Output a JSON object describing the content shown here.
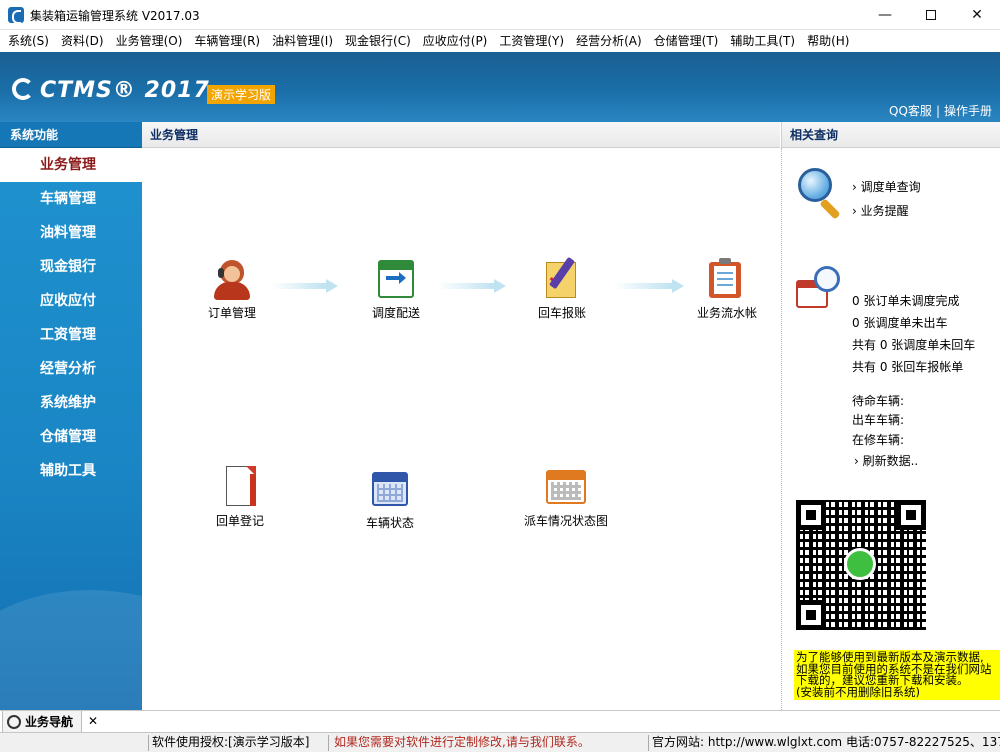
{
  "window": {
    "title": "集装箱运输管理系统 V2017.03",
    "min_glyph": "—",
    "close_glyph": "✕"
  },
  "menu": [
    "系统(S)",
    "资料(D)",
    "业务管理(O)",
    "车辆管理(R)",
    "油料管理(I)",
    "现金银行(C)",
    "应收应付(P)",
    "工资管理(Y)",
    "经营分析(A)",
    "仓储管理(T)",
    "辅助工具(T)",
    "帮助(H)"
  ],
  "banner": {
    "logo_text": "CTMS® 2017",
    "edition": "演示学习版",
    "link_qq": "QQ客服",
    "link_sep": "|",
    "link_manual": "操作手册"
  },
  "sidebar": {
    "header": "系统功能",
    "items": [
      "业务管理",
      "车辆管理",
      "油料管理",
      "现金银行",
      "应收应付",
      "工资管理",
      "经营分析",
      "系统维护",
      "仓储管理",
      "辅助工具"
    ],
    "active_index": 0
  },
  "center": {
    "header": "业务管理",
    "functions": {
      "order": "订单管理",
      "dispatch": "调度配送",
      "return": "回车报账",
      "journal": "业务流水帐",
      "receipt": "回单登记",
      "vehicle": "车辆状态",
      "dispatch_map": "派车情况状态图"
    }
  },
  "right": {
    "header": "相关查询",
    "links": [
      "› 调度单查询",
      "› 业务提醒"
    ],
    "stats": [
      "0 张订单未调度完成",
      "0 张调度单未出车",
      "共有 0 张调度单未回车",
      "共有 0 张回车报帐单"
    ],
    "vehicles": [
      "待命车辆:",
      "出车车辆:",
      "在修车辆:"
    ],
    "refresh": "› 刷新数据..",
    "notice": [
      "为了能够使用到最新版本及演示数据,",
      "如果您目前使用的系统不是在我们网站",
      "下载的，建议您重新下载和安装。",
      "(安装前不用删除旧系统)"
    ]
  },
  "bottom_nav": {
    "tab_label": "业务导航",
    "close": "✕"
  },
  "status": {
    "license": "软件使用授权:[演示学习版本]",
    "custom": "如果您需要对软件进行定制修改,请与我们联系。",
    "site": "官方网站: http://www.wlglxt.com  电话:0757-82227525、137"
  },
  "colors": {
    "banner": "#1a6ea8",
    "sidebar": "#1a85c4",
    "active_text": "#8a1a1a",
    "edition_bg": "#f2a400",
    "notice_bg": "#ffff00",
    "status_red": "#b1281f"
  }
}
